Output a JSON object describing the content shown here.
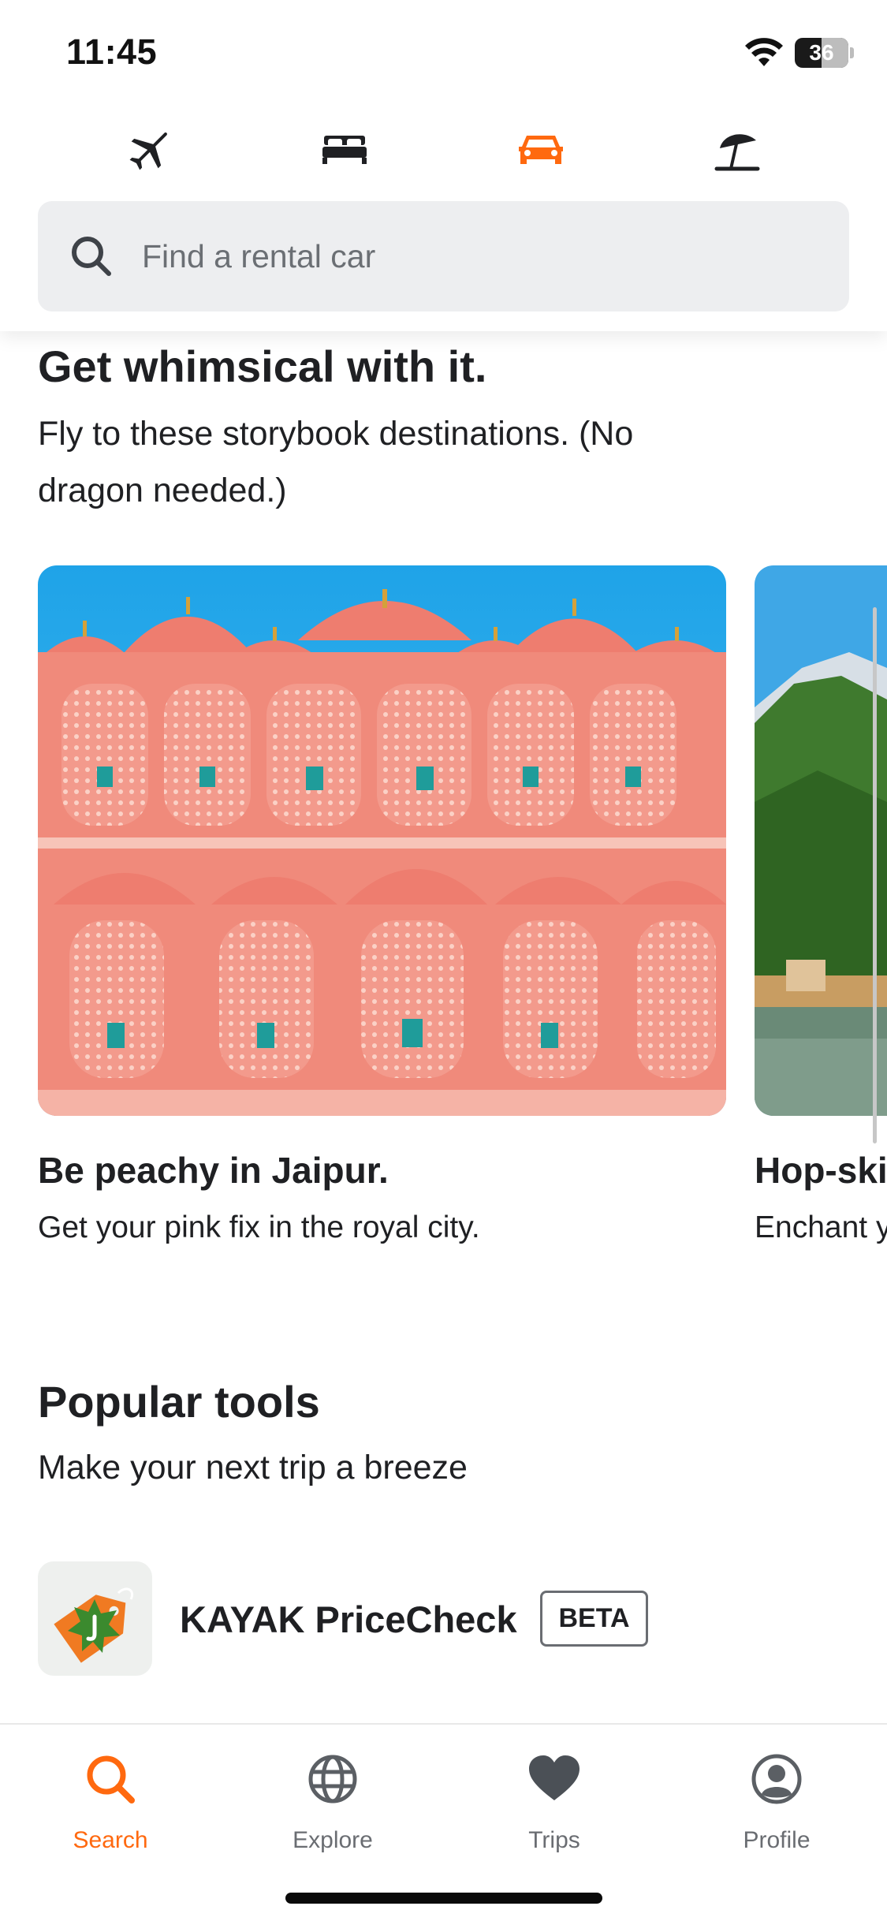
{
  "status_bar": {
    "time": "11:45",
    "battery": "36"
  },
  "header": {
    "vertical_tabs": [
      {
        "name": "flights",
        "icon": "airplane-icon",
        "active": false
      },
      {
        "name": "stays",
        "icon": "bed-icon",
        "active": false
      },
      {
        "name": "cars",
        "icon": "car-icon",
        "active": true
      },
      {
        "name": "packages",
        "icon": "beach-umbrella-icon",
        "active": false
      }
    ],
    "search": {
      "placeholder": "Find a rental car",
      "icon": "search-icon"
    }
  },
  "inspiration": {
    "title": "Get whimsical with it.",
    "subtitle_line1": "Fly to these storybook destinations. (No",
    "subtitle_line2": "dragon needed.)",
    "cards": [
      {
        "title": "Be peachy in Jaipur.",
        "subtitle": "Get your pink fix in the royal city."
      },
      {
        "title": "Hop-ski",
        "subtitle": "Enchant y"
      }
    ]
  },
  "tools": {
    "title": "Popular tools",
    "subtitle": "Make your next trip a breeze",
    "items": [
      {
        "name": "KAYAK PriceCheck",
        "badge": "BETA",
        "icon": "price-tag-icon"
      }
    ]
  },
  "bottom_nav": [
    {
      "label": "Search",
      "icon": "search-icon",
      "active": true
    },
    {
      "label": "Explore",
      "icon": "globe-icon",
      "active": false
    },
    {
      "label": "Trips",
      "icon": "heart-icon",
      "active": false
    },
    {
      "label": "Profile",
      "icon": "profile-icon",
      "active": false
    }
  ],
  "colors": {
    "accent": "#ff690f",
    "text": "#1f2023",
    "muted": "#6a6d72",
    "search_bg": "#edeef0"
  }
}
